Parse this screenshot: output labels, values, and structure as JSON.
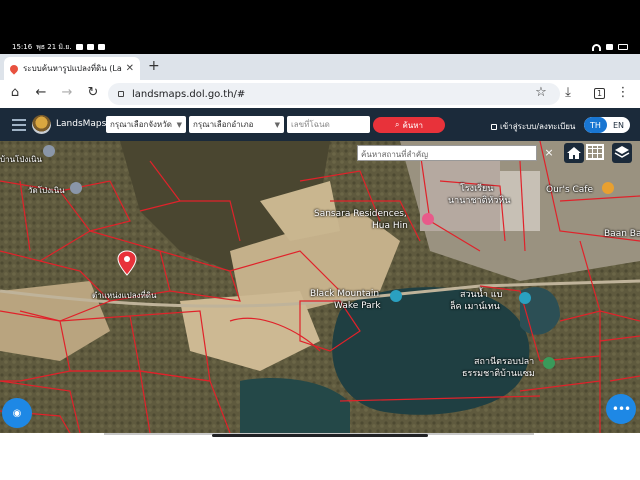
{
  "status_bar": {
    "time": "15:16",
    "date": "พุธ 21 มิ.ย."
  },
  "browser": {
    "tab_title": "ระบบค้นหารูปแปลงที่ดิน (Lands",
    "url": "landsmaps.dol.go.th/#",
    "tab_count": "1"
  },
  "app": {
    "brand": "LandsMaps",
    "province_placeholder": "กรุณาเลือกจังหวัด",
    "district_placeholder": "กรุณาเลือกอำเภอ",
    "deed_placeholder": "เลขที่โฉนด",
    "search_label": "ค้นหา",
    "login_label": "เข้าสู่ระบบ/ลงทะเบียน",
    "lang_th": "TH",
    "lang_en": "EN"
  },
  "map": {
    "place_search_placeholder": "ค้นหาสถานที่สำคัญ",
    "clear_label": "×",
    "labels": {
      "topleft": "บ้านโป่งเนิน",
      "left": "วัดโป่งเนิน",
      "marker_caption": "ตำแหน่งแปลงที่ดิน",
      "hotel_th": "โรงเรียน",
      "hotel_th2": "นานาชาติหัวหิน",
      "sansara1": "Sansara Residences,",
      "sansara2": "Hua Hin",
      "ours_cafe": "Our's Cafe",
      "baan_ba": "Baan Ba",
      "black_mountain1": "Black Mountain",
      "black_mountain2": "Wake Park",
      "water_park1": "สวนน้ำ แบ",
      "water_park2": "ล็ค เมาน์เทน",
      "station1": "สถานีตรอบปลา",
      "station2": "ธรรมชาติบ้านแซม"
    }
  },
  "icons": {
    "fab_left": "location-icon",
    "fab_right": "more-icon"
  },
  "colors": {
    "toolbar": "#1b2a3a",
    "accent_red": "#e8323a",
    "accent_blue": "#1976d2",
    "parcel_line": "#e0222a"
  }
}
